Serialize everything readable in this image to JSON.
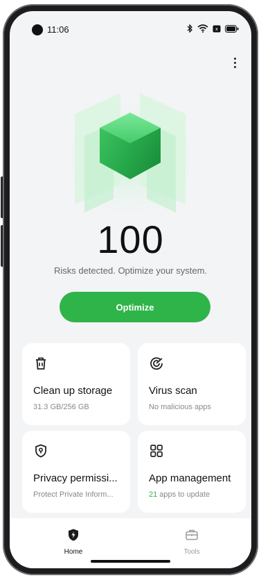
{
  "status_bar": {
    "time": "11:06"
  },
  "score": {
    "value": "100",
    "message": "Risks detected. Optimize your system."
  },
  "actions": {
    "optimize_label": "Optimize"
  },
  "cards": [
    {
      "title": "Clean up storage",
      "subtitle": "31.3 GB/256 GB",
      "icon": "trash-icon"
    },
    {
      "title": "Virus scan",
      "subtitle": "No malicious apps",
      "icon": "radar-icon"
    },
    {
      "title": "Privacy permissi...",
      "subtitle": "Protect Private Inform...",
      "icon": "shield-lock-icon"
    },
    {
      "title": "App management",
      "subtitle_count": "21",
      "subtitle_rest": " apps to update",
      "icon": "grid-icon"
    }
  ],
  "nav": {
    "items": [
      {
        "label": "Home",
        "icon": "shield-bolt-icon",
        "active": true
      },
      {
        "label": "Tools",
        "icon": "toolbox-icon",
        "active": false
      }
    ]
  },
  "colors": {
    "accent": "#2fb44a",
    "background": "#f3f4f6",
    "card": "#ffffff"
  }
}
